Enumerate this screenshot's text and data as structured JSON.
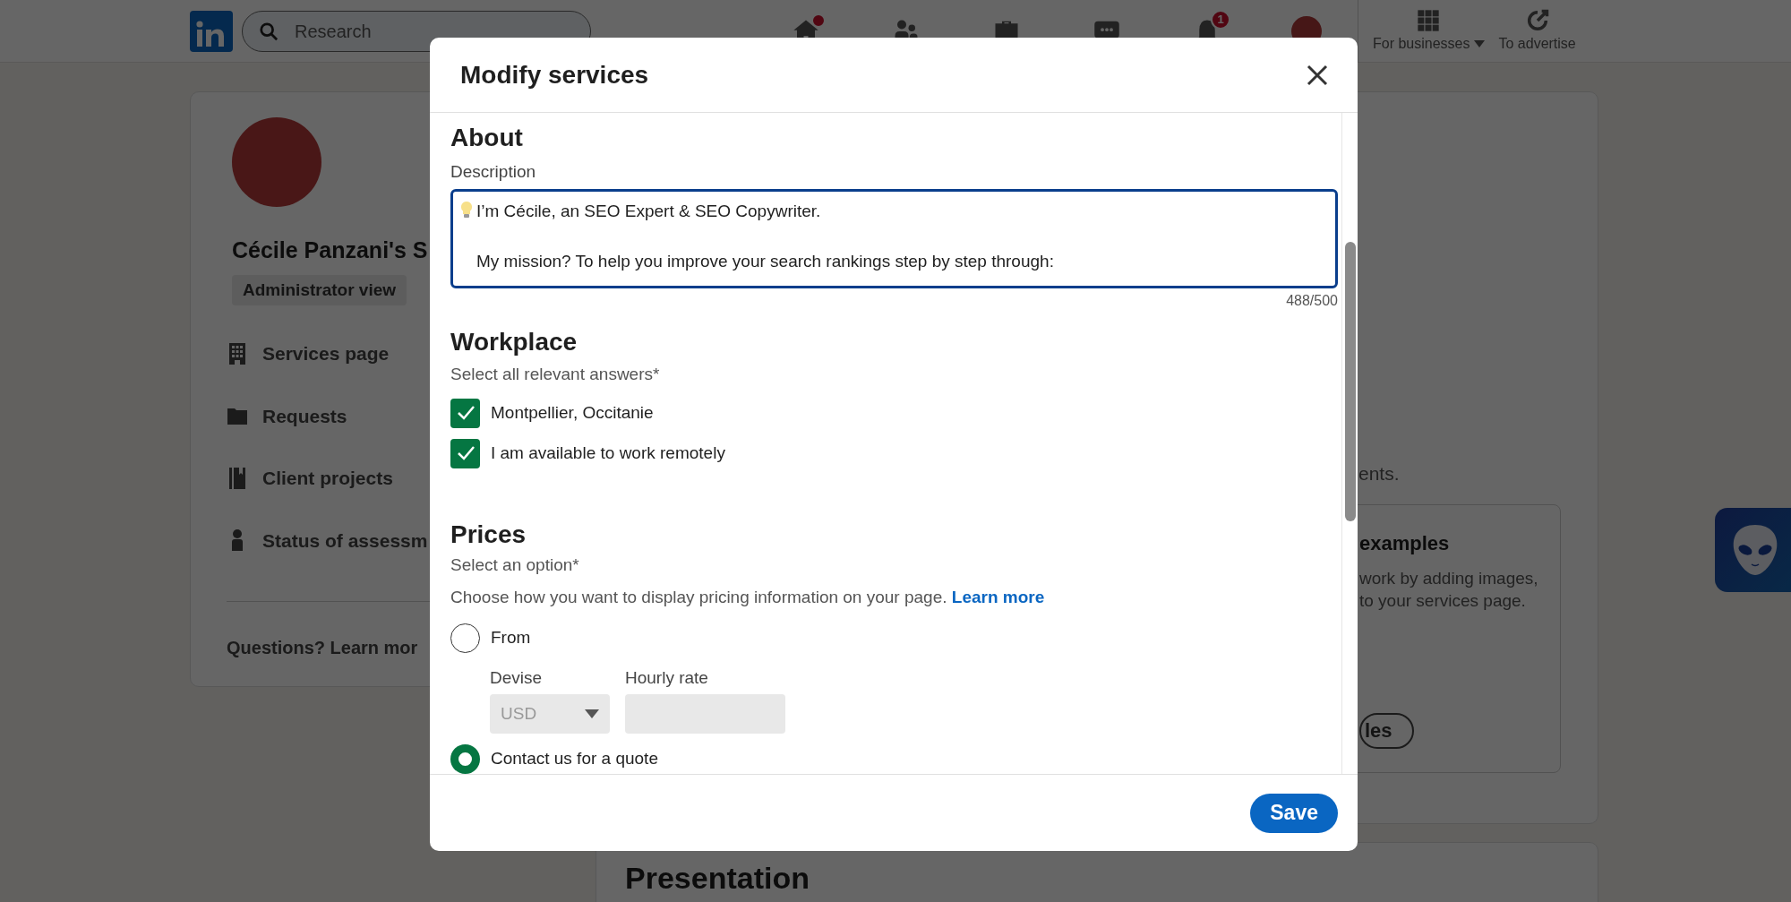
{
  "nav": {
    "search_placeholder": "Research",
    "bell_badge": "1",
    "businesses": "For businesses",
    "advertise": "To advertise"
  },
  "sidebar": {
    "name": "Cécile Panzani's S",
    "badge": "Administrator view",
    "items": [
      {
        "label": "Services page",
        "kind": "building"
      },
      {
        "label": "Requests",
        "kind": "folder"
      },
      {
        "label": "Client projects",
        "kind": "book"
      },
      {
        "label": "Status of assessm",
        "kind": "person"
      }
    ],
    "footer": "Questions? Learn mor"
  },
  "main": {
    "partial_text": "ents.",
    "examples_card": {
      "title": "examples",
      "lines": [
        "work by adding images,",
        "to your services page."
      ],
      "button": "les"
    },
    "presentation_title": "Presentation"
  },
  "modal": {
    "title": "Modify services",
    "about": {
      "heading": "About",
      "label": "Description",
      "value": "I’m Cécile, an SEO Expert & SEO Copywriter.\n\nMy mission? To help you improve your search rankings step by step through:",
      "counter": "488/500"
    },
    "workplace": {
      "heading": "Workplace",
      "hint": "Select all relevant answers*",
      "options": [
        {
          "label": "Montpellier, Occitanie",
          "checked": true
        },
        {
          "label": "I am available to work remotely",
          "checked": true
        }
      ]
    },
    "prices": {
      "heading": "Prices",
      "hint": "Select an option*",
      "text": "Choose how you want to display pricing information on your page.",
      "link": "Learn more",
      "options": [
        {
          "label": "From",
          "selected": false
        },
        {
          "label": "Contact us for a quote",
          "selected": true
        }
      ],
      "currency": {
        "label": "Devise",
        "value": "USD",
        "disabled": true
      },
      "rate": {
        "label": "Hourly rate",
        "disabled": true
      }
    },
    "save": "Save"
  }
}
